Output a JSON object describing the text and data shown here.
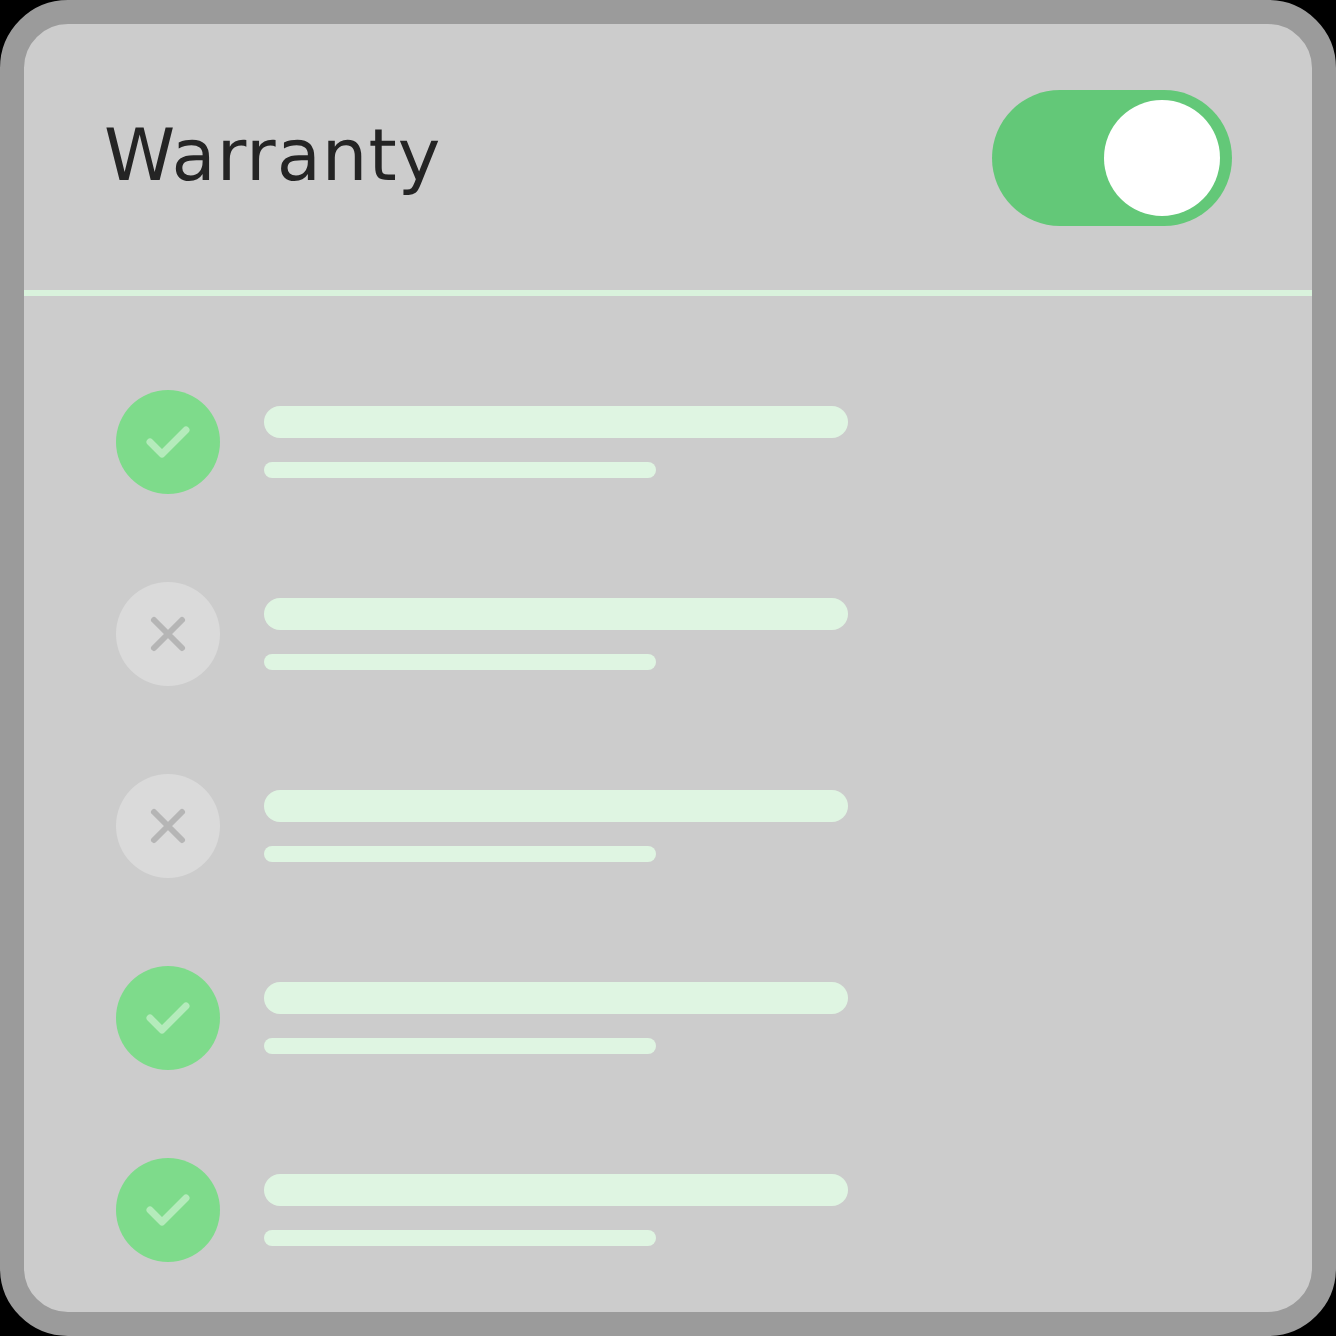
{
  "header": {
    "title": "Warranty",
    "toggle": {
      "on": true
    }
  },
  "items": [
    {
      "checked": true
    },
    {
      "checked": false
    },
    {
      "checked": false
    },
    {
      "checked": true
    },
    {
      "checked": true
    }
  ]
}
